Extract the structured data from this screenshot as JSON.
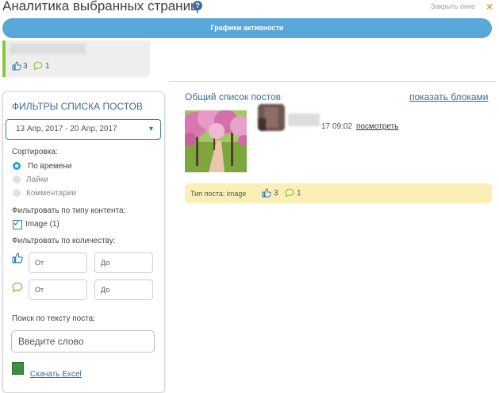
{
  "header": {
    "title": "Аналитика выбранных страниц",
    "close_label": "Закрыть окно",
    "close_icon": "×"
  },
  "activity_button": "Графики активности",
  "page_card": {
    "likes": "3",
    "comments": "1"
  },
  "filters": {
    "title": "ФИЛЬТРЫ СПИСКА ПОСТОВ",
    "date_range": "13 Апр, 2017 - 20 Апр, 2017",
    "sort_label": "Сортировка:",
    "sort_options": [
      "По времени",
      "Лайки",
      "Комментарии"
    ],
    "content_type_label": "Фильтровать по типу контента:",
    "content_type_option": "Image (1)",
    "count_label": "Фильтровать по количеству:",
    "from_placeholder": "От",
    "to_placeholder": "До",
    "search_label": "Поиск по тексту поста:",
    "search_placeholder": "Введите слово",
    "excel_link": "Скачать Excel"
  },
  "posts": {
    "title": "Общий список постов",
    "show_blocks": "показать блоками",
    "items": [
      {
        "time": "17 09:02",
        "view_link": "посмотреть",
        "type_label": "Тип поста: image",
        "likes": "3",
        "comments": "1"
      }
    ]
  },
  "colors": {
    "accent": "#5aa7d9",
    "link": "#3a6d96",
    "green": "#8cc63f",
    "footer": "#fbefb7"
  }
}
